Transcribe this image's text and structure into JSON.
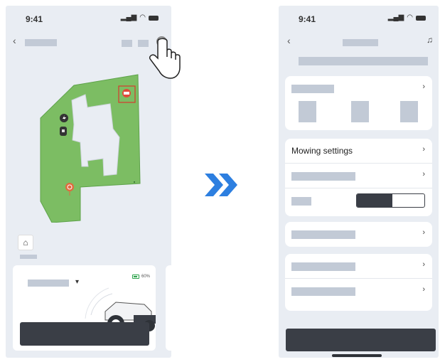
{
  "left_phone": {
    "status": {
      "time": "9:41"
    },
    "nav": {
      "back_glyph": "‹"
    },
    "home": {
      "glyph": "⌂"
    },
    "mower_card": {
      "battery_text": "60%",
      "dropdown_glyph": "▾"
    }
  },
  "right_phone": {
    "status": {
      "time": "9:41"
    },
    "nav": {
      "back_glyph": "‹",
      "support_glyph": "♫"
    },
    "cards": {
      "first": {
        "chevron": "›"
      },
      "mowing": {
        "label": "Mowing settings",
        "chevron": "›"
      },
      "single": {
        "chevron": "›"
      },
      "last": {
        "chevron": "›"
      }
    }
  },
  "colors": {
    "lawn": "#7cbd63",
    "phone_bg": "#e9edf3",
    "placeholder": "#c2cad6",
    "dark": "#3a3e46",
    "arrow_blue": "#2d7fe0"
  },
  "icons": {
    "signal": "signal-icon",
    "wifi": "wifi-icon",
    "battery": "battery-icon",
    "settings": "settings-icon",
    "charging_station": "charging-station-icon",
    "mower": "mower-icon",
    "camera": "camera-icon",
    "location": "location-pin-icon",
    "home": "home-icon",
    "pointer": "hand-pointer-icon",
    "arrow": "double-chevron-right-icon"
  }
}
